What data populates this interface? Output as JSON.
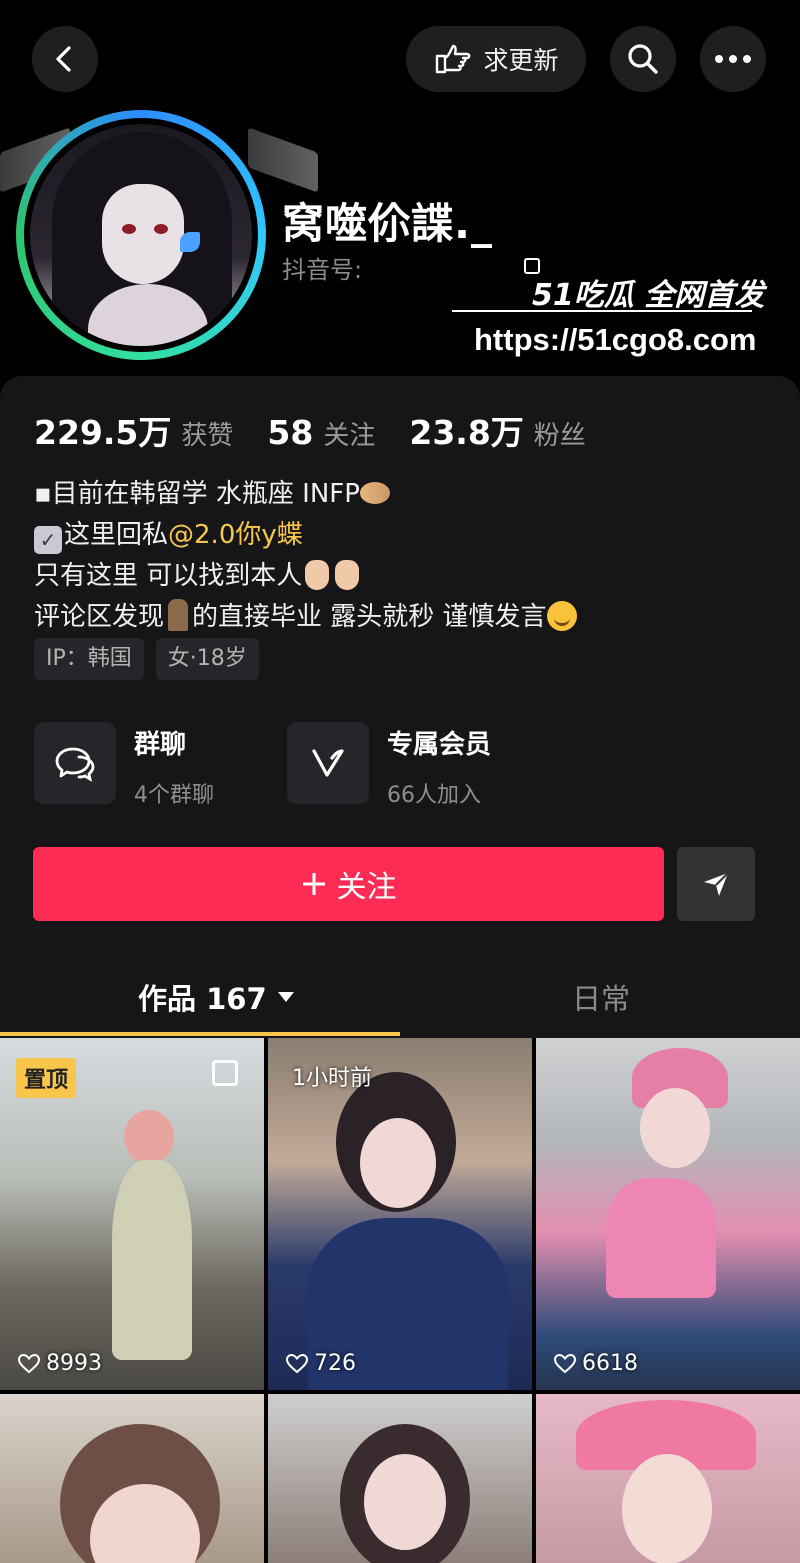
{
  "topbar": {
    "back_icon": "chevron-left-icon",
    "update_label": "求更新",
    "update_icon": "pointing-hand-icon",
    "search_icon": "search-icon",
    "more_icon": "more-dots-icon"
  },
  "profile": {
    "nickname": "窝噬伱諜._",
    "douyin_id_label": "抖音号:",
    "avatar_ring_colors": [
      "#2d8cff",
      "#33e0a0"
    ]
  },
  "watermark": {
    "brand": "51吃瓜 全网首发",
    "url": "https://51cgo8.com"
  },
  "stats": [
    {
      "value": "229.5万",
      "label": "获赞"
    },
    {
      "value": "58",
      "label": "关注"
    },
    {
      "value": "23.8万",
      "label": "粉丝"
    }
  ],
  "bio": {
    "line1": "▪目前在韩留学 水瓶座 INFP",
    "line2_prefix": "这里回私",
    "line2_mention": "@2.0你y蝶",
    "line3": "只有这里 可以找到本人",
    "line4_a": "评论区发现",
    "line4_b": "的直接毕业 露头就秒 谨慎发言"
  },
  "tags": [
    "IP：韩国",
    "女·18岁"
  ],
  "features": {
    "group": {
      "title": "群聊",
      "sub": "4个群聊",
      "icon": "chat-bubbles-icon"
    },
    "member": {
      "title": "专属会员",
      "sub": "66人加入",
      "icon": "vip-v-icon"
    }
  },
  "actions": {
    "follow_label": "关注",
    "follow_color": "#fe2c55",
    "share_icon": "send-arrow-icon"
  },
  "tabs": {
    "works_label": "作品 167",
    "daily_label": "日常",
    "active_color": "#f7c64b"
  },
  "videos": [
    {
      "likes": "8993",
      "badge": "置顶"
    },
    {
      "likes": "726",
      "time": "1小时前"
    },
    {
      "likes": "6618"
    },
    {},
    {},
    {}
  ]
}
